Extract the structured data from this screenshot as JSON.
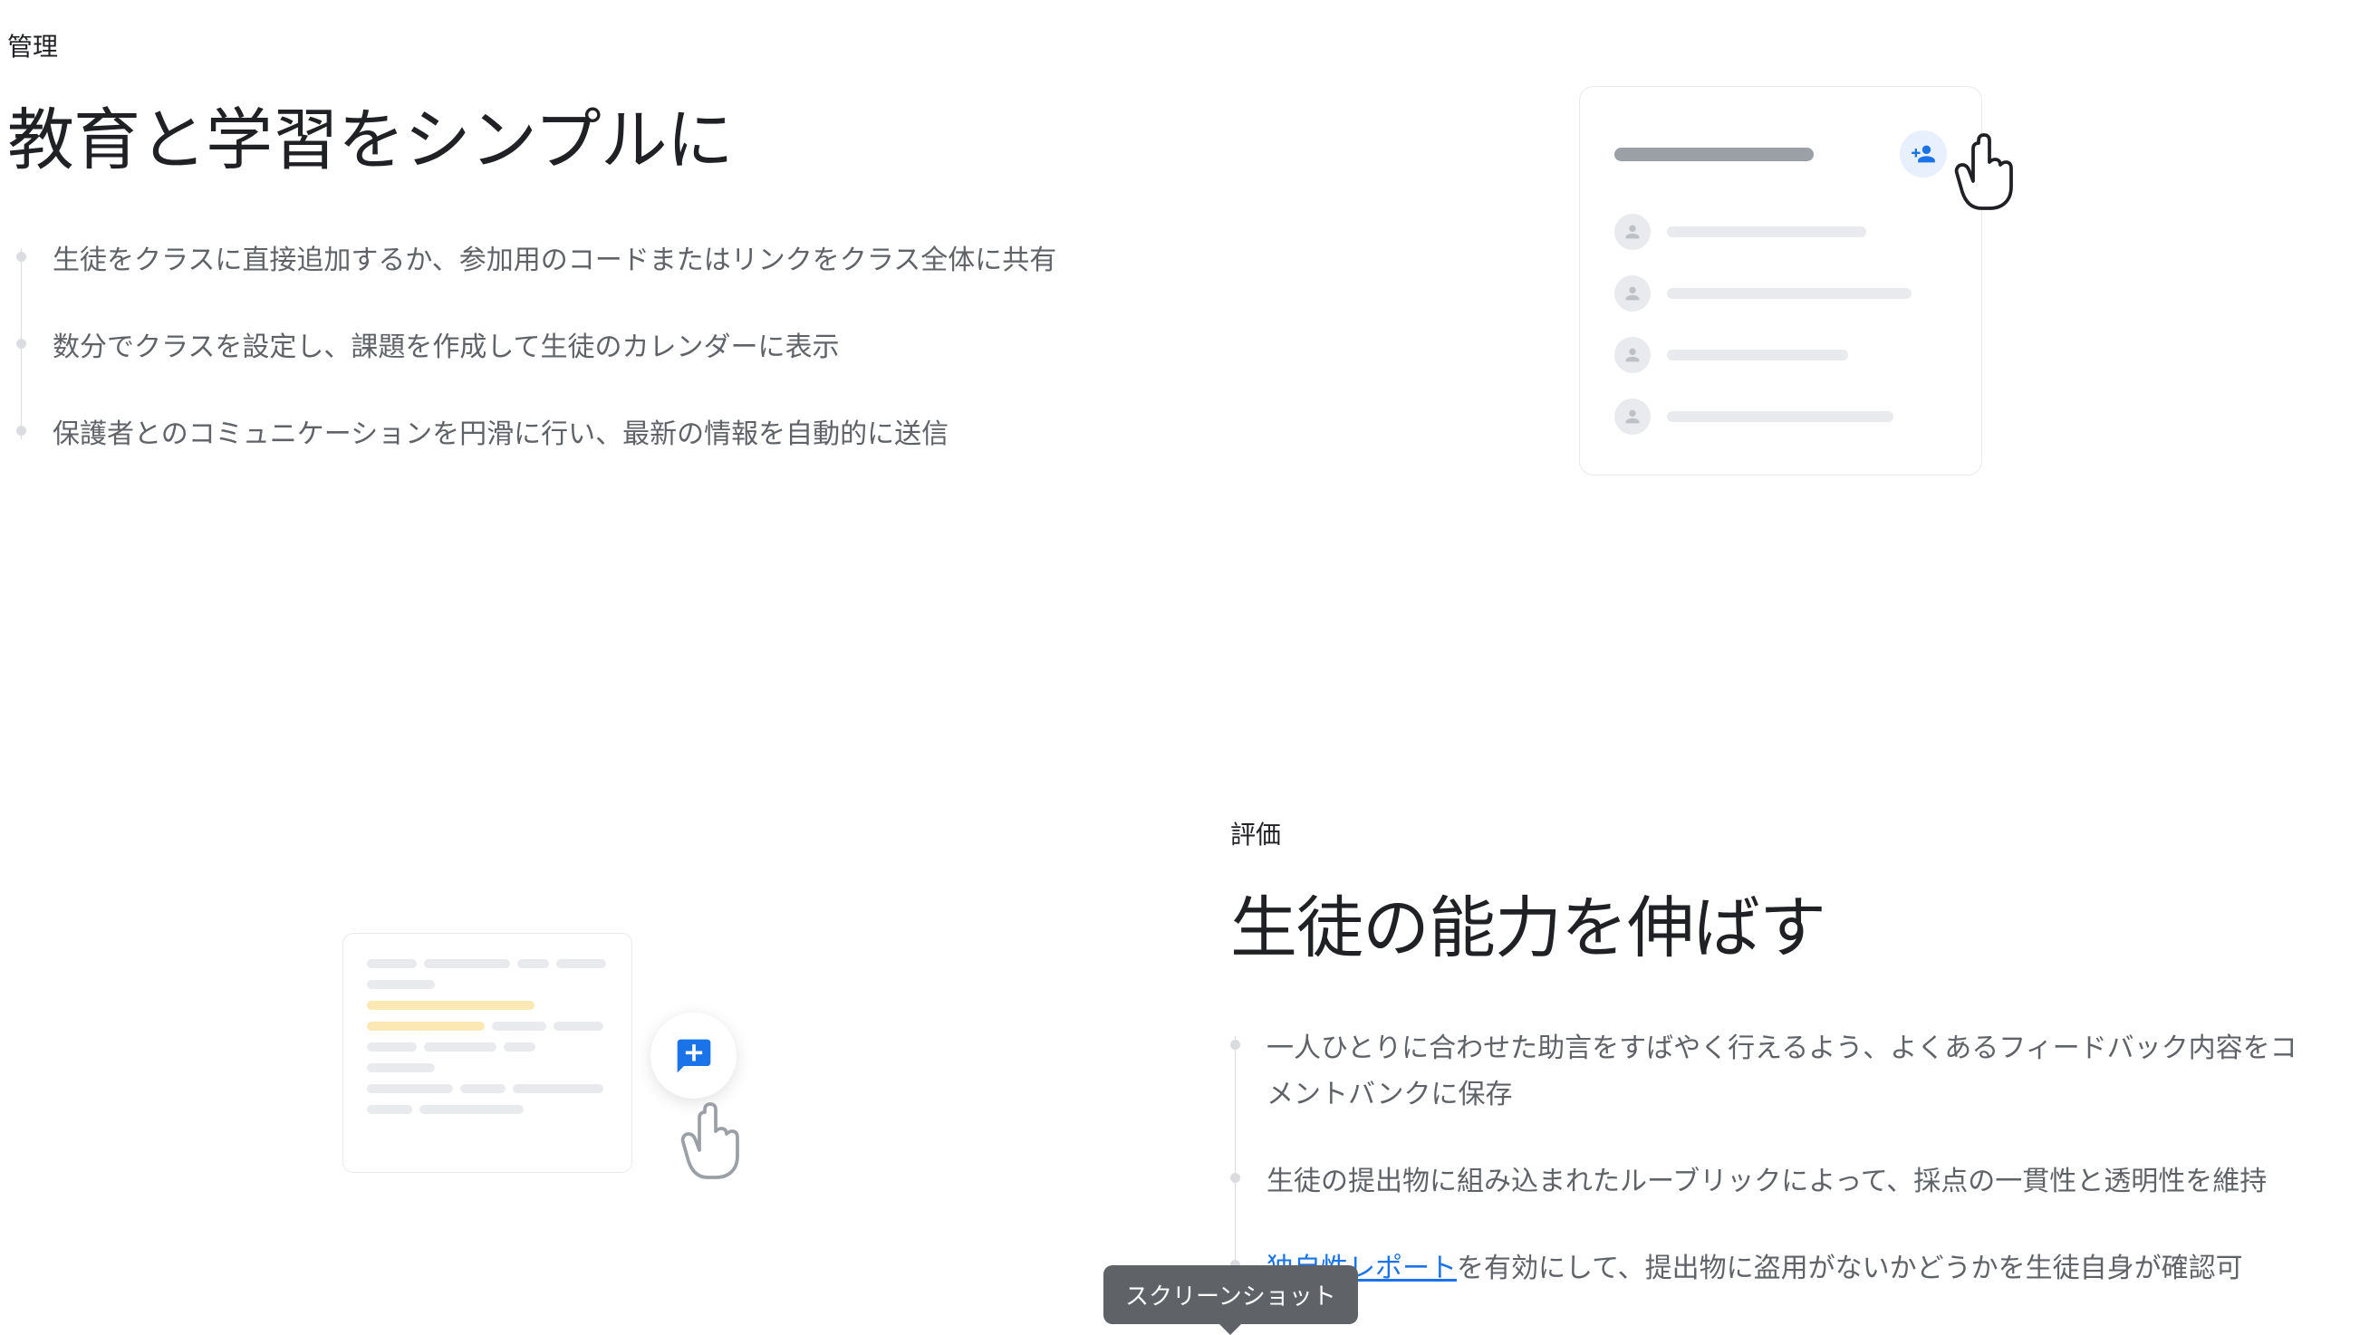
{
  "section1": {
    "eyebrow": "管理",
    "heading": "教育と学習をシンプルに",
    "bullets": [
      "生徒をクラスに直接追加するか、参加用のコードまたはリンクをクラス全体に共有",
      "数分でクラスを設定し、課題を作成して生徒のカレンダーに表示",
      "保護者とのコミュニケーションを円滑に行い、最新の情報を自動的に送信"
    ]
  },
  "section2": {
    "eyebrow": "評価",
    "heading": "生徒の能力を伸ばす",
    "bullets": [
      "一人ひとりに合わせた助言をすばやく行えるよう、よくあるフィードバック内容をコメントバンクに保存",
      "生徒の提出物に組み込まれたルーブリックによって、採点の一貫性と透明性を維持"
    ],
    "bullet3_link": "独自性レポート",
    "bullet3_tail": "を有効にして、提出物に盗用がないかどうかを生徒自身が確認可"
  },
  "tooltip": "スクリーンショット",
  "icons": {
    "add_person": "person-add-icon",
    "avatar": "person-icon",
    "cursor": "pointer-hand-icon",
    "comment": "add-comment-icon"
  }
}
